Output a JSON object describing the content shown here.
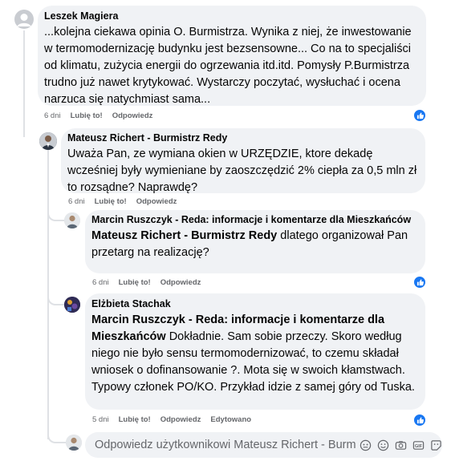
{
  "comments": [
    {
      "author": "Leszek Magiera",
      "text": "...kolejna ciekawa opinia O. Burmistrza. Wynika z niej, że inwestowanie w termomodernizację budynku jest bezsensowne... Co na to specjaliści od klimatu, zużycia energii do ogrzewania itd.itd. Pomysły P.Burmistrza trudno już nawet krytykować. Wystarczy poczytać, wysłuchać i ocena narzuca się natychmiast sama...",
      "time": "6 dni",
      "like": "Lubię to!",
      "reply": "Odpowiedz"
    },
    {
      "author": "Mateusz Richert - Burmistrz Redy",
      "text": "Uważa Pan, ze wymiana okien w URZĘDZIE, ktore dekadę wcześniej były wymieniane by zaoszczędzić 2% ciepła za 0,5 mln zł to rozsądne? Naprawdę?",
      "time": "6 dni",
      "like": "Lubię to!",
      "reply": "Odpowiedz"
    },
    {
      "author": "Marcin Ruszczyk - Reda: informacje i komentarze dla Mieszkańców",
      "mention": "Mateusz Richert - Burmistrz Redy",
      "text": " dlatego organizował Pan przetarg na realizację?",
      "time": "6 dni",
      "like": "Lubię to!",
      "reply": "Odpowiedz"
    },
    {
      "author": "Elżbieta Stachak",
      "mention": "Marcin Ruszczyk - Reda: informacje i komentarze dla Mieszkańców",
      "text": " Dokładnie. Sam sobie przeczy. Skoro według niego nie było sensu termomodernizować, to czemu składał wniosek o dofinansowanie ?. Mota się w swoich kłamstwach. Typowy członek PO/KO. Przykład idzie z samej góry od Tuska.",
      "time": "5 dni",
      "like": "Lubię to!",
      "reply": "Odpowiedz",
      "edited": "Edytowano"
    }
  ],
  "reply_box": {
    "placeholder": "Odpowiedz użytkownikowi Mateusz Richert - Burmistrz Redy..."
  },
  "colors": {
    "bubble": "#f0f2f5",
    "like_blue": "#1877f2",
    "meta_gray": "#65676b"
  }
}
